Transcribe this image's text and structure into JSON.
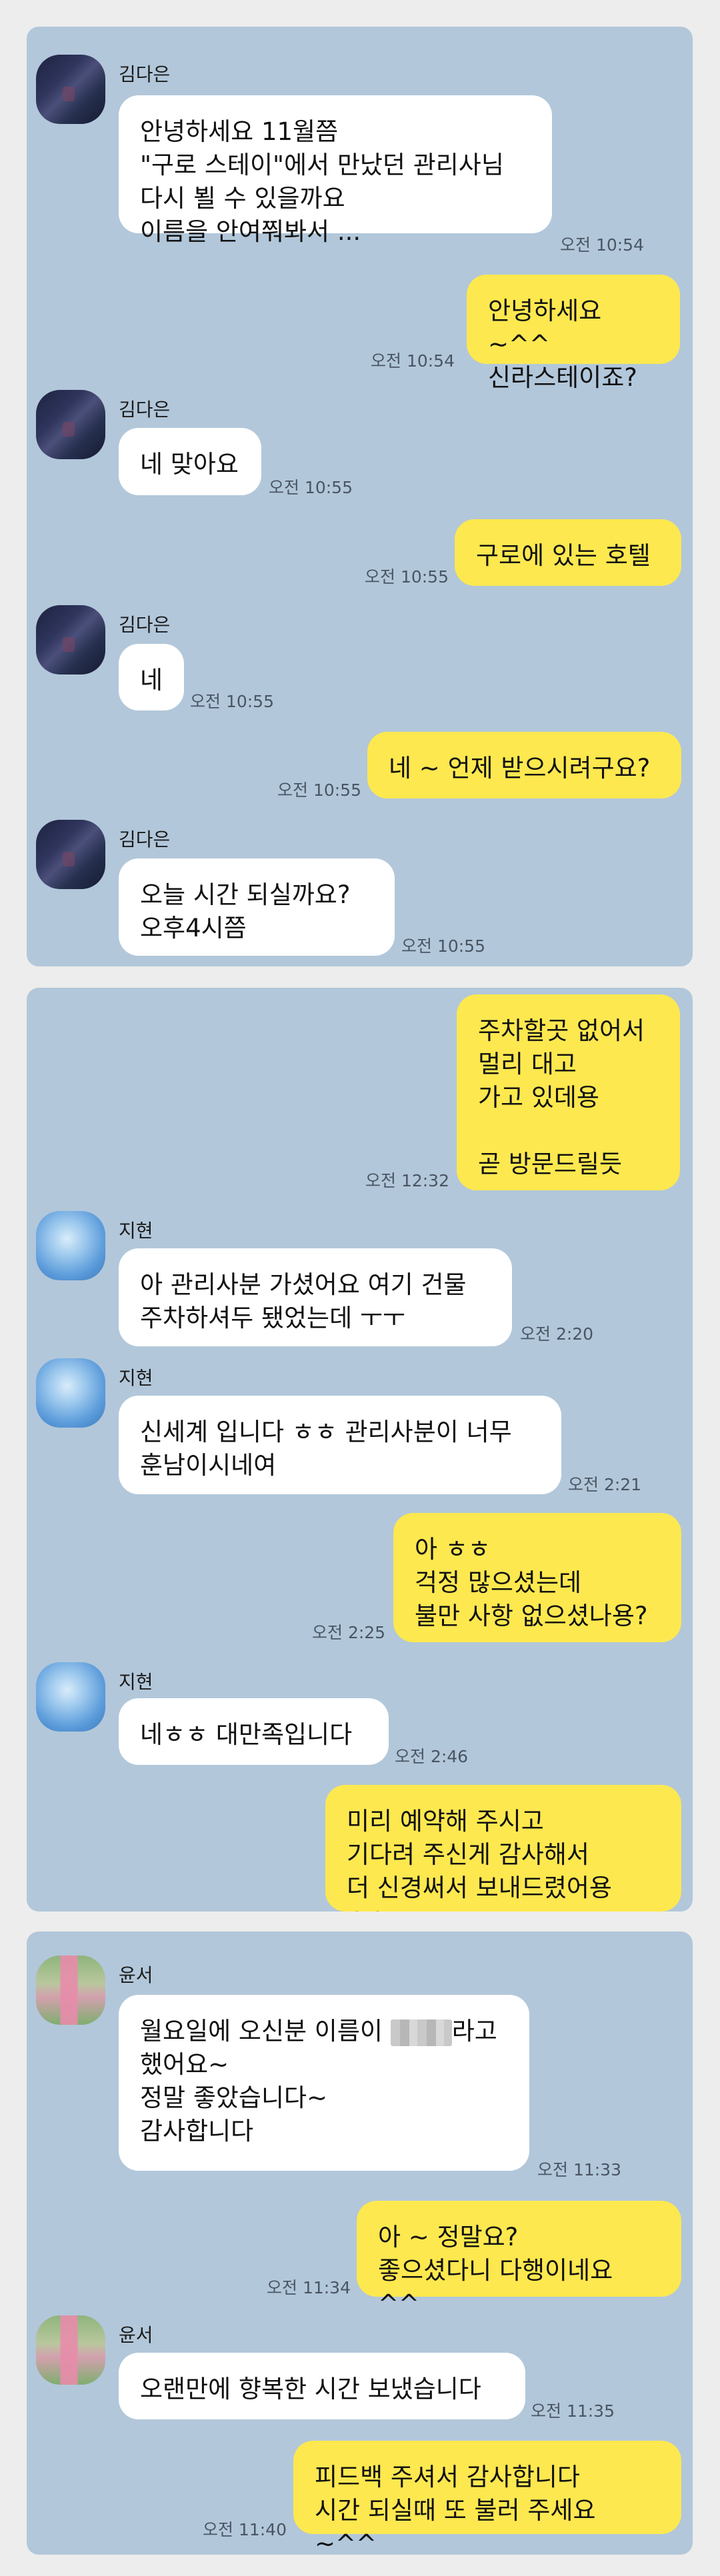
{
  "panel1": {
    "contact_name": "김다은",
    "messages": [
      {
        "text": "안녕하세요 11월쯤\n\"구로 스테이\"에서 만났던 관리사님\n다시 뵐 수 있을까요\n이름을 안여쭤봐서 ...",
        "time": "오전 10:54"
      },
      {
        "text": "안녕하세요 ~^^\n신라스테이죠?",
        "time": "오전 10:54"
      },
      {
        "text": "네 맞아요",
        "time": "오전 10:55"
      },
      {
        "text": "구로에 있는 호텔",
        "time": "오전 10:55"
      },
      {
        "text": "네",
        "time": "오전 10:55"
      },
      {
        "text": "네 ~ 언제 받으시려구요?",
        "time": "오전 10:55"
      },
      {
        "text": "오늘  시간 되실까요?\n오후4시쯤",
        "time": "오전 10:55"
      }
    ]
  },
  "panel2": {
    "contact_name": "지현",
    "messages": [
      {
        "text": "주차할곳 없어서\n멀리 대고\n가고 있데용\n\n곧 방문드릴듯",
        "time": "오전 12:32"
      },
      {
        "text": "아 관리사분 가셨어요 여기 건물\n주차하셔두 됐었는데 ㅜㅜ",
        "time": "오전 2:20"
      },
      {
        "text": "신세계 입니다 ㅎㅎ 관리사분이 너무\n훈남이시네여",
        "time": "오전 2:21"
      },
      {
        "text": "아 ㅎㅎ\n걱정 많으셨는데\n불만 사항 없으셨나용?",
        "time": "오전 2:25"
      },
      {
        "text": "네ㅎㅎ 대만족입니다",
        "time": "오전 2:46"
      },
      {
        "text": "미리 예약해 주시고\n기다려 주신게 감사해서\n더 신경써서 보내드렸어용 ^^",
        "time": ""
      }
    ]
  },
  "panel3": {
    "contact_name": "윤서",
    "messages": [
      {
        "text_before": "월요일에 오신분 이름이 ",
        "text_after": "라고\n했어요~\n정말 좋았습니다~\n감사합니다",
        "time": "오전 11:33"
      },
      {
        "text": "아 ~ 정말요?\n좋으셨다니 다행이네요 ^^",
        "time": "오전 11:34"
      },
      {
        "text": "오랜만에 향복한 시간 보냈습니다",
        "time": "오전 11:35"
      },
      {
        "text": "피드백 주셔서 감사합니다\n시간 되실때 또 불러 주세요 ~^^",
        "time": "오전 11:40"
      }
    ]
  }
}
